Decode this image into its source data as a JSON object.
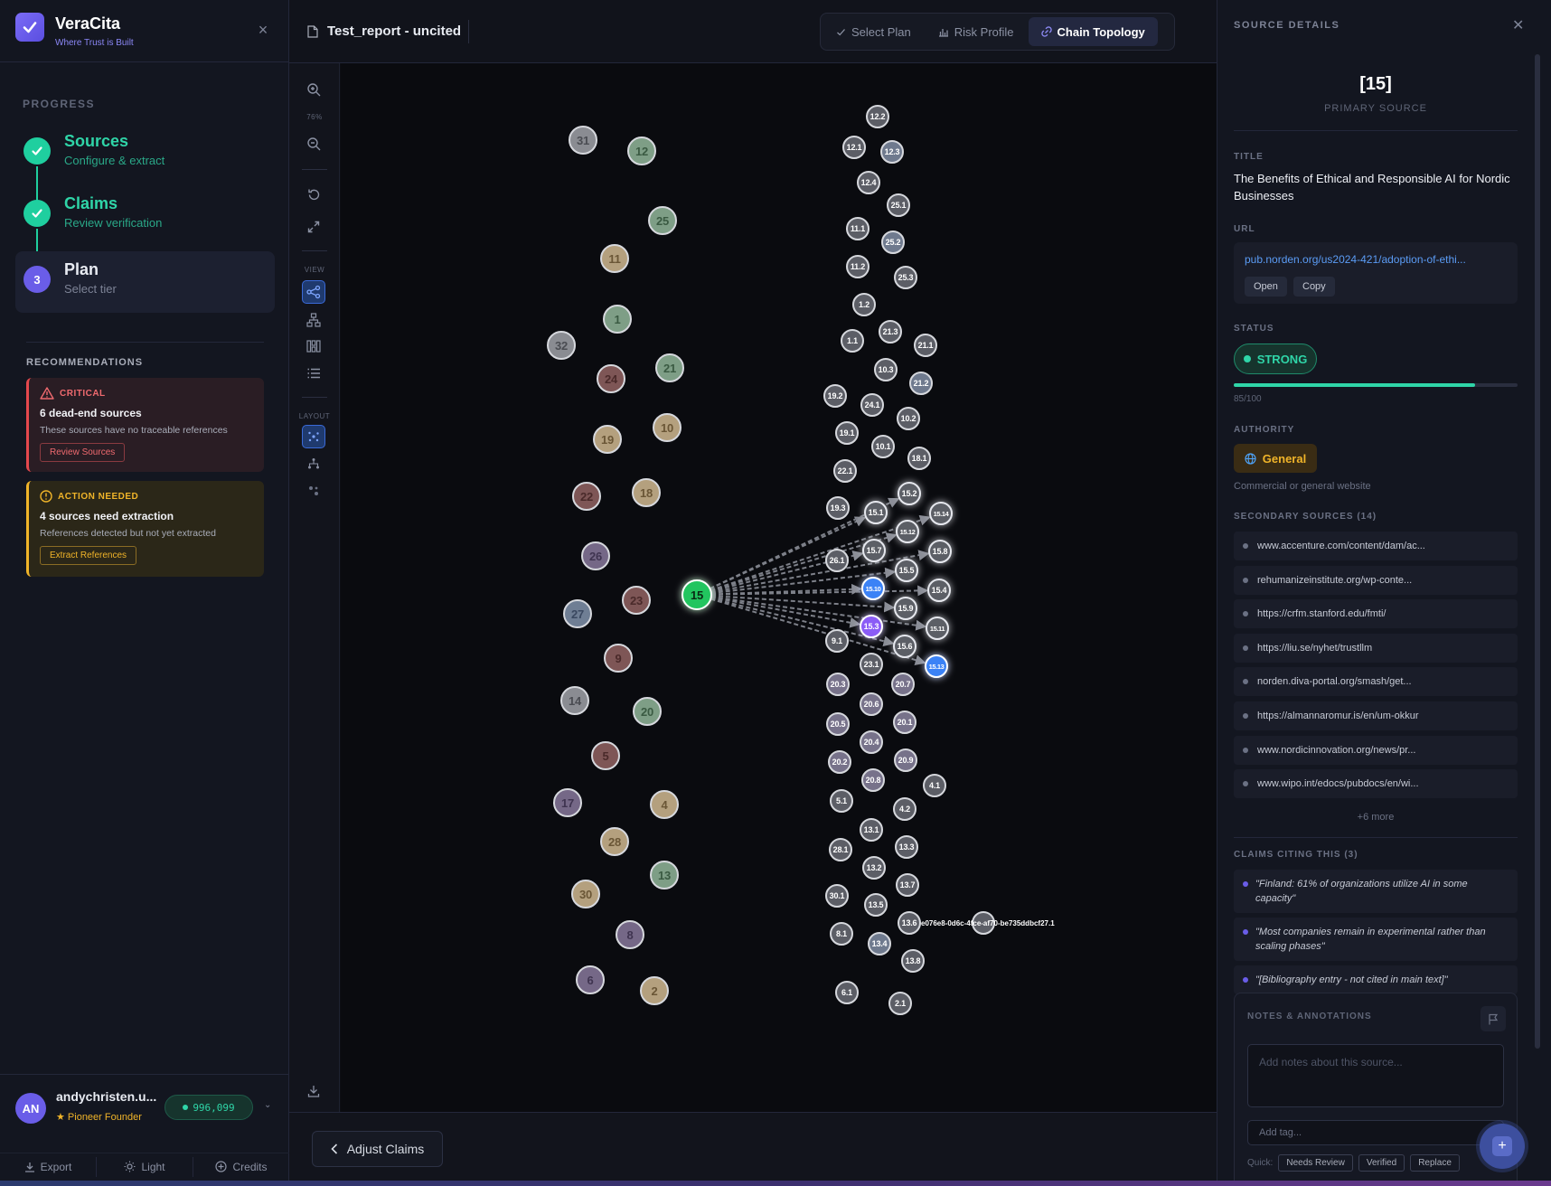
{
  "brand": {
    "name": "VeraCita",
    "tagline": "Where Trust is Built"
  },
  "progress": {
    "heading": "PROGRESS",
    "steps": [
      {
        "title": "Sources",
        "subtitle": "Configure & extract",
        "state": "done"
      },
      {
        "title": "Claims",
        "subtitle": "Review verification",
        "state": "done"
      },
      {
        "number": "3",
        "title": "Plan",
        "subtitle": "Select tier",
        "state": "current"
      }
    ]
  },
  "recommendations": {
    "heading": "RECOMMENDATIONS",
    "critical": {
      "tag": "CRITICAL",
      "title": "6 dead-end sources",
      "desc": "These sources have no traceable references",
      "button": "Review Sources"
    },
    "action": {
      "tag": "ACTION NEEDED",
      "title": "4 sources need extraction",
      "desc": "References detected but not yet extracted",
      "button": "Extract References"
    }
  },
  "user": {
    "initials": "AN",
    "name": "andychristen.u...",
    "tier": "★ Pioneer Founder",
    "credits": "996,099"
  },
  "footer": {
    "export": "Export",
    "theme": "Light",
    "credits": "Credits"
  },
  "doc": {
    "title": "Test_report - uncited"
  },
  "tabs": {
    "select_plan": "Select Plan",
    "risk_profile": "Risk Profile",
    "chain_topology": "Chain Topology"
  },
  "rail": {
    "zoom": "76%",
    "view_label": "VIEW",
    "layout_label": "LAYOUT"
  },
  "bottom": {
    "adjust_claims": "Adjust Claims"
  },
  "colors": {
    "accent": "#6a5de8",
    "strong": "#2fd5a8",
    "general": "#f0b429",
    "critical": "#e5484d",
    "selected": "#3b82f6"
  },
  "panel": {
    "heading": "SOURCE DETAILS",
    "id": "[15]",
    "id_sub": "PRIMARY SOURCE",
    "title_label": "TITLE",
    "title": "The Benefits of Ethical and Responsible AI for Nordic Businesses",
    "url_label": "URL",
    "url": "pub.norden.org/us2024-421/adoption-of-ethi...",
    "open": "Open",
    "copy": "Copy",
    "status_label": "STATUS",
    "status": "STRONG",
    "score": 85,
    "score_text": "85/100",
    "authority_label": "AUTHORITY",
    "authority": "General",
    "authority_desc": "Commercial or general website",
    "secondary_label": "SECONDARY SOURCES (14)",
    "secondary": [
      "www.accenture.com/content/dam/ac...",
      "rehumanizeinstitute.org/wp-conte...",
      "https://crfm.stanford.edu/fmti/",
      "https://liu.se/nyhet/trustllm",
      "norden.diva-portal.org/smash/get...",
      "https://almannaromur.is/en/um-okkur",
      "www.nordicinnovation.org/news/pr...",
      "www.wipo.int/edocs/pubdocs/en/wi..."
    ],
    "more": "+6 more",
    "claims_label": "CLAIMS CITING THIS (3)",
    "claims": [
      "\"Finland: 61% of organizations utilize AI in some capacity\"",
      "\"Most companies remain in experimental rather than scaling phases\"",
      "\"[Bibliography entry - not cited in main text]\""
    ],
    "notes_label": "NOTES & ANNOTATIONS",
    "notes_placeholder": "Add notes about this source...",
    "tag_placeholder": "Add tag...",
    "quick_label": "Quick:",
    "quick": [
      "Needs Review",
      "Verified",
      "Replace"
    ]
  },
  "graph": {
    "nodes": [
      {
        "id": "31",
        "cat": "gray",
        "r": "l"
      },
      {
        "id": "12",
        "cat": "green",
        "r": "l"
      },
      {
        "id": "25",
        "cat": "green",
        "r": "l"
      },
      {
        "id": "11",
        "cat": "tan",
        "r": "l"
      },
      {
        "id": "1",
        "cat": "green",
        "r": "l"
      },
      {
        "id": "32",
        "cat": "gray",
        "r": "l"
      },
      {
        "id": "24",
        "cat": "red",
        "r": "l"
      },
      {
        "id": "21",
        "cat": "green",
        "r": "l"
      },
      {
        "id": "19",
        "cat": "tan",
        "r": "l"
      },
      {
        "id": "10",
        "cat": "tan",
        "r": "l"
      },
      {
        "id": "22",
        "cat": "red",
        "r": "l"
      },
      {
        "id": "18",
        "cat": "tan",
        "r": "l"
      },
      {
        "id": "26",
        "cat": "purple",
        "r": "l"
      },
      {
        "id": "27",
        "cat": "blue",
        "r": "l"
      },
      {
        "id": "23",
        "cat": "red",
        "r": "l"
      },
      {
        "id": "9",
        "cat": "red",
        "r": "l"
      },
      {
        "id": "14",
        "cat": "gray",
        "r": "l"
      },
      {
        "id": "20",
        "cat": "green",
        "r": "l"
      },
      {
        "id": "5",
        "cat": "red",
        "r": "l"
      },
      {
        "id": "17",
        "cat": "purple",
        "r": "l"
      },
      {
        "id": "4",
        "cat": "tan",
        "r": "l"
      },
      {
        "id": "28",
        "cat": "tan",
        "r": "l"
      },
      {
        "id": "13",
        "cat": "green",
        "r": "l"
      },
      {
        "id": "30",
        "cat": "tan",
        "r": "l"
      },
      {
        "id": "8",
        "cat": "purple",
        "r": "l"
      },
      {
        "id": "6",
        "cat": "purple",
        "r": "l"
      },
      {
        "id": "2",
        "cat": "tan",
        "r": "l"
      },
      {
        "id": "15",
        "cat": "primary",
        "r": "l"
      },
      {
        "id": "12.2",
        "cat": "dgray"
      },
      {
        "id": "12.1",
        "cat": "dgray"
      },
      {
        "id": "12.3",
        "cat": "slate"
      },
      {
        "id": "12.4",
        "cat": "dgray"
      },
      {
        "id": "25.1",
        "cat": "dgray"
      },
      {
        "id": "11.1",
        "cat": "dgray"
      },
      {
        "id": "25.2",
        "cat": "slate"
      },
      {
        "id": "11.2",
        "cat": "dgray"
      },
      {
        "id": "25.3",
        "cat": "dgray"
      },
      {
        "id": "1.2",
        "cat": "dgray"
      },
      {
        "id": "21.3",
        "cat": "dgray"
      },
      {
        "id": "1.1",
        "cat": "dgray"
      },
      {
        "id": "21.1",
        "cat": "dgray"
      },
      {
        "id": "10.3",
        "cat": "dgray"
      },
      {
        "id": "21.2",
        "cat": "slate"
      },
      {
        "id": "19.2",
        "cat": "dgray"
      },
      {
        "id": "24.1",
        "cat": "dgray"
      },
      {
        "id": "10.2",
        "cat": "dgray"
      },
      {
        "id": "19.1",
        "cat": "dgray"
      },
      {
        "id": "10.1",
        "cat": "dgray"
      },
      {
        "id": "18.1",
        "cat": "dgray"
      },
      {
        "id": "22.1",
        "cat": "dgray"
      },
      {
        "id": "15.2",
        "cat": "child"
      },
      {
        "id": "19.3",
        "cat": "dgray"
      },
      {
        "id": "15.1",
        "cat": "child"
      },
      {
        "id": "15.14",
        "cat": "child"
      },
      {
        "id": "15.12",
        "cat": "child"
      },
      {
        "id": "15.7",
        "cat": "child"
      },
      {
        "id": "15.8",
        "cat": "child"
      },
      {
        "id": "26.1",
        "cat": "dgray"
      },
      {
        "id": "15.5",
        "cat": "child"
      },
      {
        "id": "15.10",
        "cat": "sel"
      },
      {
        "id": "15.4",
        "cat": "child"
      },
      {
        "id": "15.9",
        "cat": "child"
      },
      {
        "id": "15.3",
        "cat": "violet"
      },
      {
        "id": "15.11",
        "cat": "child"
      },
      {
        "id": "9.1",
        "cat": "dgray"
      },
      {
        "id": "15.6",
        "cat": "child"
      },
      {
        "id": "23.1",
        "cat": "dgray"
      },
      {
        "id": "15.13",
        "cat": "sel"
      },
      {
        "id": "20.3",
        "cat": "lav"
      },
      {
        "id": "20.7",
        "cat": "lav"
      },
      {
        "id": "20.6",
        "cat": "lav"
      },
      {
        "id": "20.5",
        "cat": "lav"
      },
      {
        "id": "20.1",
        "cat": "lav"
      },
      {
        "id": "20.4",
        "cat": "lav"
      },
      {
        "id": "20.2",
        "cat": "lav"
      },
      {
        "id": "20.9",
        "cat": "lav"
      },
      {
        "id": "20.8",
        "cat": "lav"
      },
      {
        "id": "4.1",
        "cat": "dgray"
      },
      {
        "id": "5.1",
        "cat": "dgray"
      },
      {
        "id": "4.2",
        "cat": "dgray"
      },
      {
        "id": "13.1",
        "cat": "dgray"
      },
      {
        "id": "28.1",
        "cat": "dgray"
      },
      {
        "id": "13.3",
        "cat": "dgray"
      },
      {
        "id": "13.2",
        "cat": "dgray"
      },
      {
        "id": "13.7",
        "cat": "dgray"
      },
      {
        "id": "30.1",
        "cat": "dgray"
      },
      {
        "id": "13.5",
        "cat": "dgray"
      },
      {
        "id": "13.6",
        "cat": "dgray"
      },
      {
        "id": "8.1",
        "cat": "dgray"
      },
      {
        "id": "13.4",
        "cat": "slate"
      },
      {
        "id": "13.8",
        "cat": "dgray"
      },
      {
        "id": "6.1",
        "cat": "dgray"
      },
      {
        "id": "2.1",
        "cat": "dgray"
      },
      {
        "id": "ext",
        "cat": "dgray"
      }
    ],
    "ext_label": "e076e8-0d6c-4fce-af70-be735ddbcf27.1",
    "edges_from": "15",
    "edges_to": [
      "15.1",
      "15.2",
      "15.3",
      "15.4",
      "15.5",
      "15.6",
      "15.7",
      "15.8",
      "15.9",
      "15.10",
      "15.11",
      "15.12",
      "15.13",
      "15.14"
    ]
  }
}
